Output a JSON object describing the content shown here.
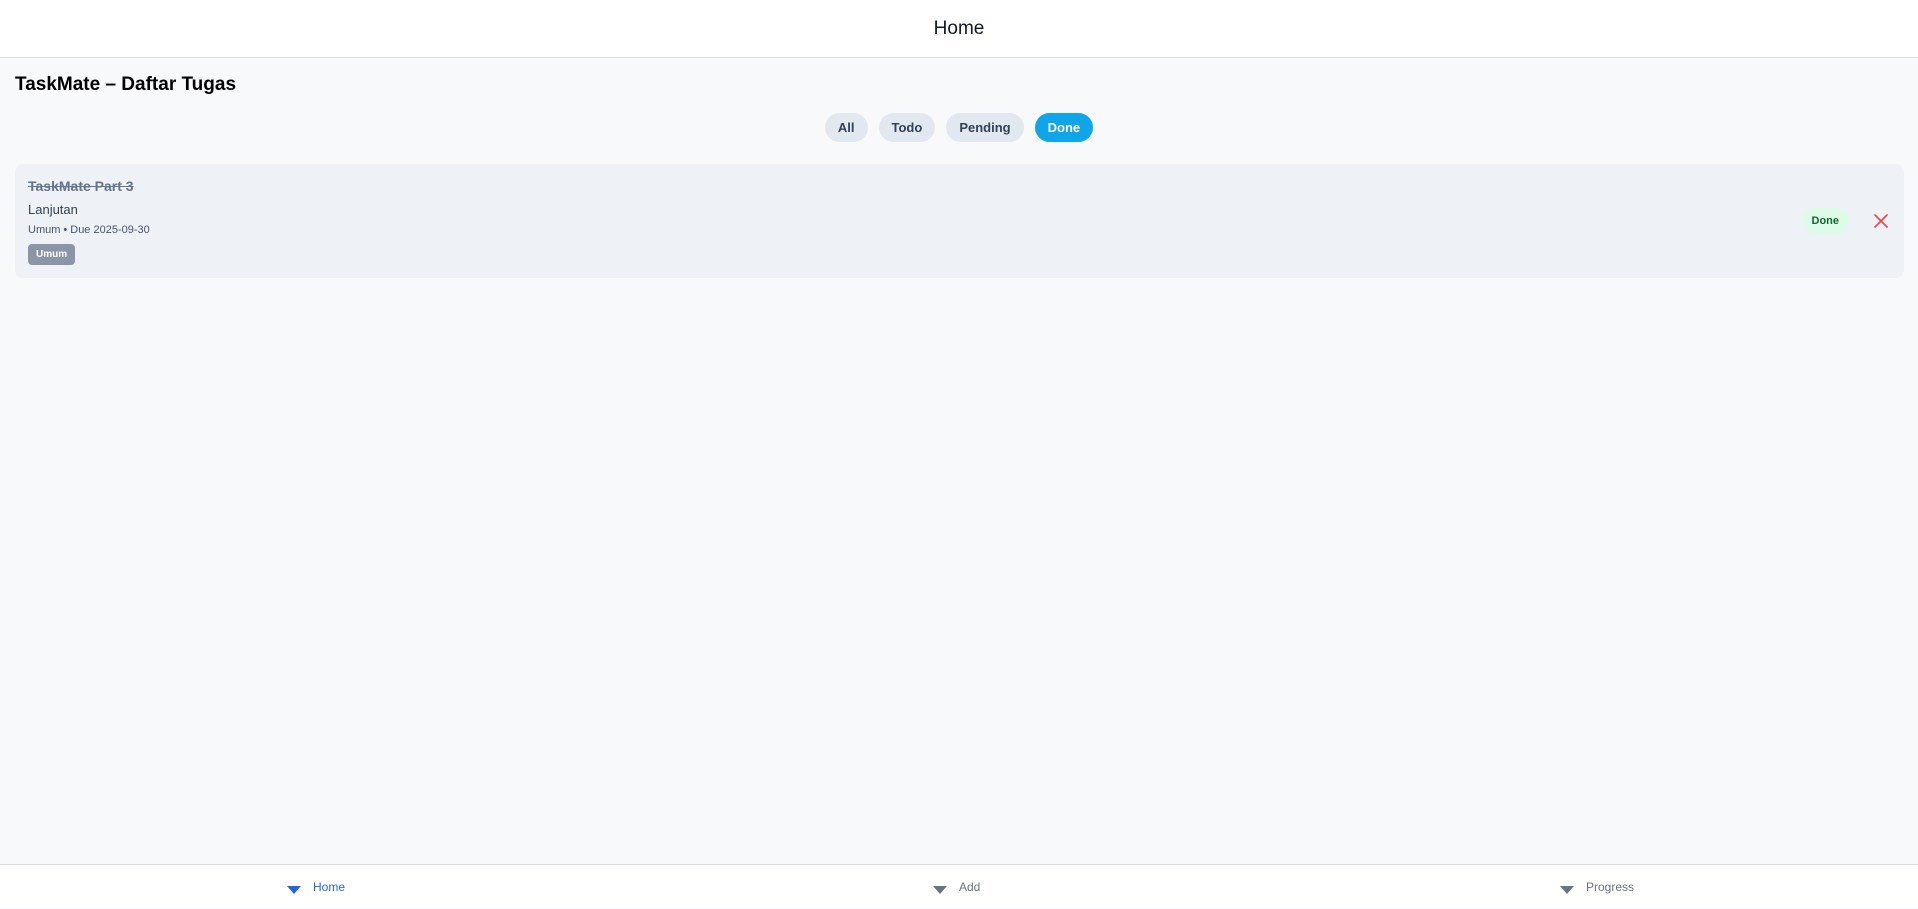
{
  "header": {
    "title": "Home"
  },
  "page": {
    "title": "TaskMate – Daftar Tugas"
  },
  "filters": [
    {
      "label": "All",
      "active": false
    },
    {
      "label": "Todo",
      "active": false
    },
    {
      "label": "Pending",
      "active": false
    },
    {
      "label": "Done",
      "active": true
    }
  ],
  "tasks": [
    {
      "title": "TaskMate Part 3",
      "description": "Lanjutan",
      "category": "Umum",
      "separator": "•",
      "due": "Due 2025-09-30",
      "tag": "Umum",
      "status": "Done",
      "delete_icon": "close-icon"
    }
  ],
  "bottom_nav": [
    {
      "label": "Home",
      "icon": "chevron-down-icon",
      "active": true
    },
    {
      "label": "Add",
      "icon": "chevron-down-icon",
      "active": false
    },
    {
      "label": "Progress",
      "icon": "chevron-down-icon",
      "active": false
    }
  ],
  "colors": {
    "accent": "#0ea5e9",
    "nav_active": "#2563eb",
    "done_bg": "#dcfce7",
    "done_text": "#166534",
    "delete": "#ef4444"
  }
}
